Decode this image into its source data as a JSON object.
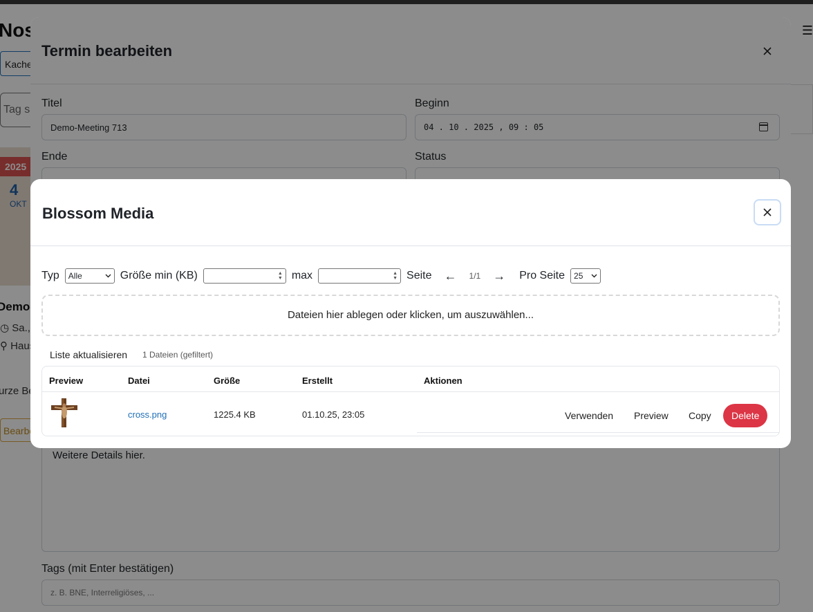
{
  "background": {
    "brand": "Nos",
    "view_tab": "Kache",
    "search_placeholder": "Tag su",
    "card": {
      "year": "2025",
      "day": "4",
      "month": "OKT",
      "title": "Demo-",
      "meta_date": "Sa., C",
      "meta_place": "Haus",
      "description": "urze Be",
      "edit_button": "Bearbe"
    }
  },
  "termin": {
    "title": "Termin bearbeiten",
    "fields": {
      "titel_label": "Titel",
      "titel_value": "Demo-Meeting 713",
      "beginn_label": "Beginn",
      "beginn_value": "04 . 10 . 2025 ,  09 : 05",
      "ende_label": "Ende",
      "status_label": "Status",
      "details_value": "Weitere Details hier.",
      "tags_label": "Tags (mit Enter bestätigen)",
      "tags_placeholder": "z. B. BNE, Interreligiöses, ..."
    }
  },
  "media": {
    "title": "Blossom Media",
    "filters": {
      "typ_label": "Typ",
      "typ_value": "Alle",
      "size_min_label": "Größe min (KB)",
      "max_label": "max",
      "page_label": "Seite",
      "prev": "←",
      "page_value": "1/1",
      "next": "→",
      "per_page_label": "Pro Seite",
      "per_page_value": "25"
    },
    "dropzone": "Dateien hier ablegen oder klicken, um auszuwählen...",
    "refresh_label": "Liste aktualisieren",
    "count_text": "1 Dateien (gefiltert)",
    "table": {
      "columns": [
        "Preview",
        "Datei",
        "Größe",
        "Erstellt",
        "Aktionen"
      ],
      "rows": [
        {
          "file": "cross.png",
          "size": "1225.4 KB",
          "created": "01.10.25, 23:05",
          "actions": [
            "Verwenden",
            "Preview",
            "Copy",
            "Delete"
          ]
        }
      ]
    }
  }
}
